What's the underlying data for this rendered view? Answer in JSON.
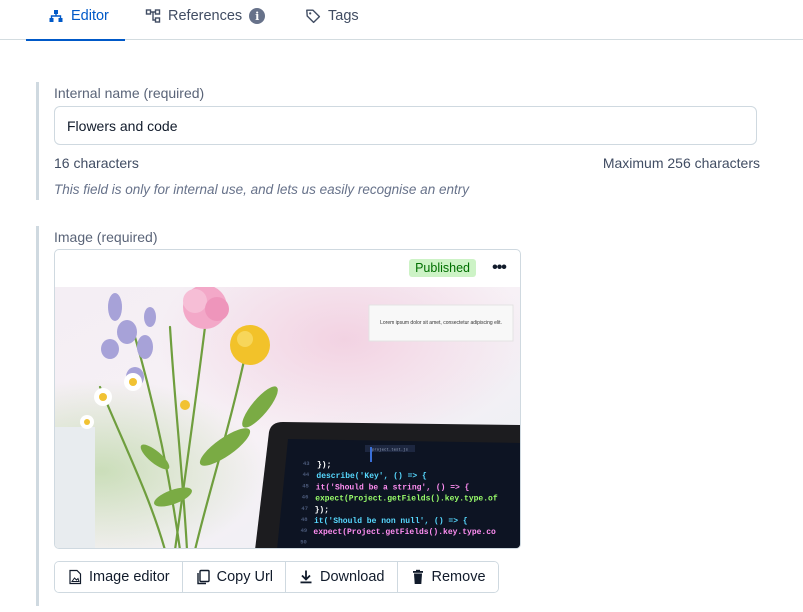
{
  "tabs": [
    {
      "label": "Editor",
      "icon": "editor-icon",
      "active": true
    },
    {
      "label": "References",
      "icon": "references-icon",
      "active": false
    },
    {
      "label": "Tags",
      "icon": "tag-icon",
      "active": false
    }
  ],
  "fields": {
    "internal_name": {
      "label": "Internal name (required)",
      "value": "Flowers and code",
      "count": "16 characters",
      "max": "Maximum 256 characters",
      "help": "This field is only for internal use, and lets us easily recognise an entry"
    },
    "image": {
      "label": "Image (required)",
      "status": "Published",
      "status_color": "#cdf3c6",
      "caption_text": "Lorem ipsum dolor sit amet, consectetur adipiscing elit.",
      "code_tab": "project.test.js",
      "code_lines": [
        "});",
        "describe('Key', () => {",
        "  it('Should be a string', () => {",
        "    expect(Project.getFields().key.type.of",
        "  });",
        "  it('Should be non null', () => {",
        "    expect(Project.getFields().key.type.co"
      ],
      "code_line_numbers": [
        "43",
        "44",
        "45",
        "46",
        "47",
        "48",
        "49",
        "50"
      ]
    }
  },
  "toolbar": {
    "image_editor": "Image editor",
    "copy_url": "Copy Url",
    "download": "Download",
    "remove": "Remove"
  },
  "colors": {
    "accent": "#0059c8",
    "text": "#414d63",
    "border": "#cfd9e0"
  }
}
